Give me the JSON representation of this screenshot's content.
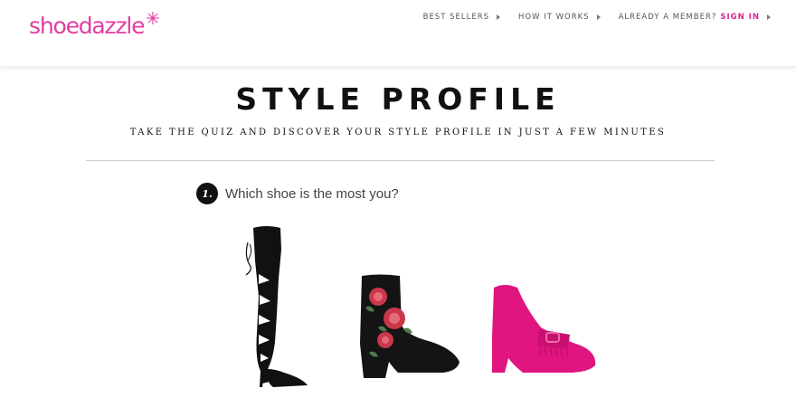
{
  "header": {
    "logo": "shoedazzle",
    "nav": [
      {
        "label": "BEST SELLERS"
      },
      {
        "label": "HOW IT WORKS"
      },
      {
        "label": "ALREADY A MEMBER?",
        "accent": "SIGN IN"
      }
    ]
  },
  "main": {
    "title": "STYLE PROFILE",
    "subtitle": "TAKE THE QUIZ AND DISCOVER YOUR STYLE PROFILE IN JUST A FEW MINUTES",
    "question": {
      "number": "1.",
      "text": "Which shoe is the most you?"
    },
    "options": [
      {
        "icon": "over-the-knee-boot-icon",
        "color": "#111111"
      },
      {
        "icon": "floral-ankle-bootie-icon",
        "color": "#1a1a1a"
      },
      {
        "icon": "pink-block-heel-pump-icon",
        "color": "#e0157f"
      }
    ]
  },
  "colors": {
    "brand": "#e23ea3",
    "accent": "#d6238f"
  }
}
